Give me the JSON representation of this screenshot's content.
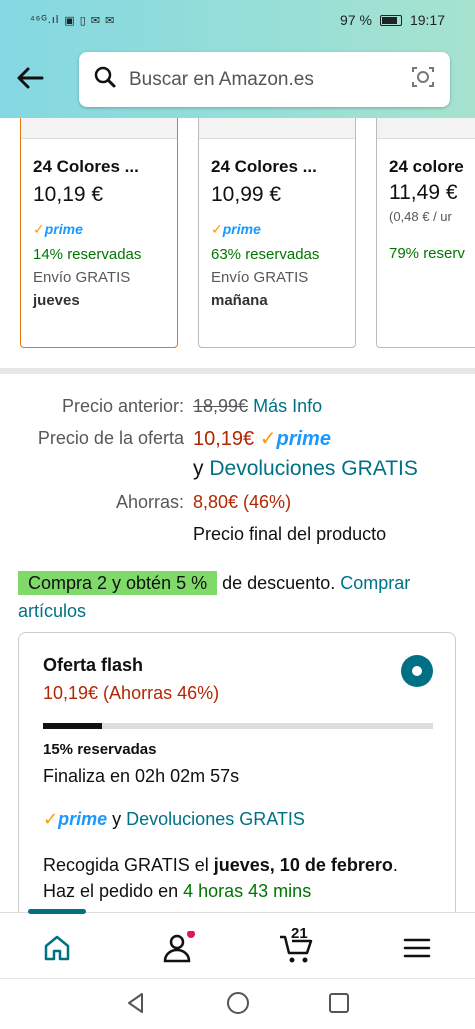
{
  "status_bar": {
    "signal": "⁴⁶ᴳ.ıl",
    "icons": "▣ ▯ ✉ ✉",
    "battery": "97 %",
    "time": "19:17"
  },
  "header": {
    "search_placeholder": "Buscar en Amazon.es",
    "back_icon": "arrow-left-icon",
    "camera_icon": "camera-scan-icon"
  },
  "carousel": [
    {
      "title": "24 Colores ...",
      "price": "10,19 €",
      "unit": "",
      "prime": "prime",
      "reserved": "14% reservadas",
      "shipping": "Envío GRATIS",
      "delivery": "jueves",
      "selected": true
    },
    {
      "title": "24 Colores ...",
      "price": "10,99 €",
      "unit": "",
      "prime": "prime",
      "reserved": "63% reservadas",
      "shipping": "Envío GRATIS",
      "delivery": "mañana",
      "selected": false
    },
    {
      "title": "24 colore",
      "price": "11,49 €",
      "unit": "(0,48 € / ur",
      "prime": "",
      "reserved": "79% reserv",
      "shipping": "",
      "delivery": "",
      "selected": false
    }
  ],
  "pricing": {
    "previous_label": "Precio anterior:",
    "previous_price": "18,99€",
    "more_info": "Más Info",
    "deal_label": "Precio de la oferta",
    "deal_price": "10,19€",
    "prime": "prime",
    "returns_prefix": "y",
    "returns_link": "Devoluciones GRATIS",
    "savings_label": "Ahorras:",
    "savings_value": "8,80€ (46%)",
    "final_note": "Precio final del producto"
  },
  "promo": {
    "badge": "Compra 2 y obtén 5 %",
    "text": "de descuento.",
    "link_1": "Comprar",
    "link_2": "artículos"
  },
  "flash_deal": {
    "title": "Oferta flash",
    "price_line": "10,19€ (Ahorras 46%)",
    "reserved_percent": 15,
    "reserved": "15% reservadas",
    "ends": "Finaliza en 02h 02m 57s",
    "prime": "prime",
    "returns_prefix": "y",
    "returns_link": "Devoluciones GRATIS",
    "pickup_prefix": "Recogida GRATIS el",
    "pickup_date": "jueves, 10 de febrero",
    "pickup_suffix": ".",
    "order_prefix": "Haz el pedido en",
    "order_time": "4 horas 43 mins"
  },
  "bottom_nav": {
    "cart_count": "21"
  },
  "colors": {
    "teal": "#007185",
    "price_red": "#b12704",
    "green": "#007600",
    "prime_blue": "#1a98ff",
    "orange": "#ff9900",
    "badge_green": "#7fda6a"
  }
}
